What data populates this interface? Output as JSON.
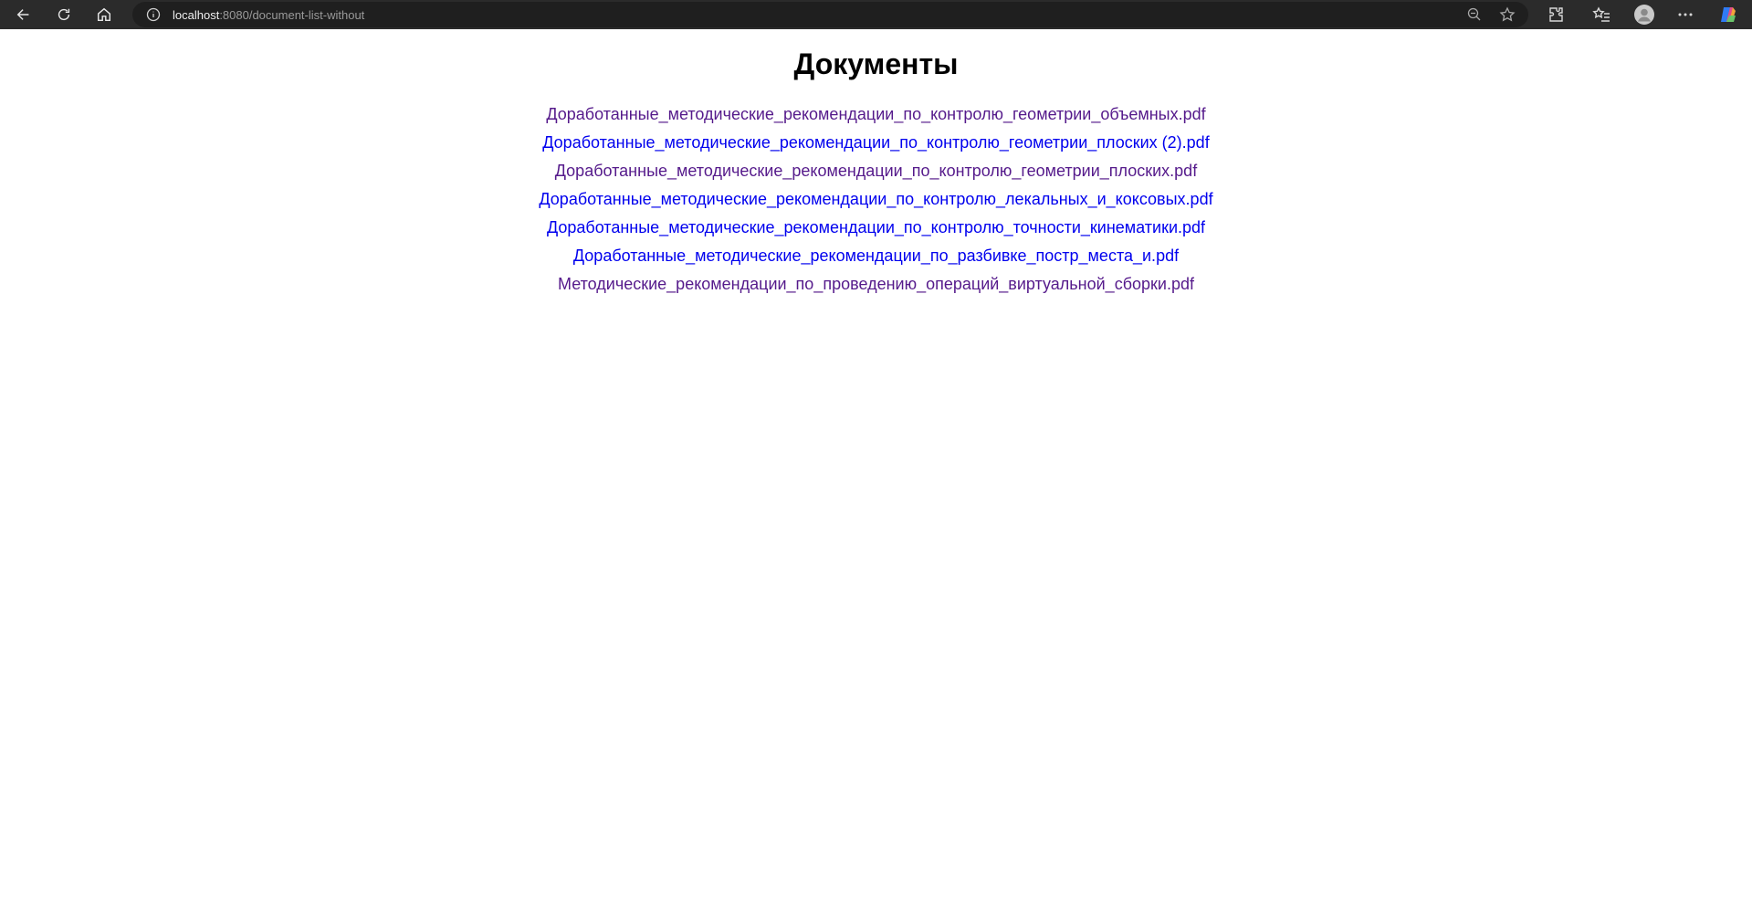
{
  "browser": {
    "url_host": "localhost",
    "url_path": ":8080/document-list-without"
  },
  "page": {
    "title": "Документы"
  },
  "documents": [
    {
      "label": "Доработанные_методические_рекомендации_по_контролю_геометрии_объемных.pdf",
      "visited": true
    },
    {
      "label": "Доработанные_методические_рекомендации_по_контролю_геометрии_плоских (2).pdf",
      "visited": false
    },
    {
      "label": "Доработанные_методические_рекомендации_по_контролю_геометрии_плоских.pdf",
      "visited": true
    },
    {
      "label": "Доработанные_методические_рекомендации_по_контролю_лекальных_и_коксовых.pdf",
      "visited": false
    },
    {
      "label": "Доработанные_методические_рекомендации_по_контролю_точности_кинематики.pdf",
      "visited": false
    },
    {
      "label": "Доработанные_методические_рекомендации_по_разбивке_постр_места_и.pdf",
      "visited": false
    },
    {
      "label": "Методические_рекомендации_по_проведению_операций_виртуальной_сборки.pdf",
      "visited": true
    }
  ],
  "colors": {
    "link": "#0000ee",
    "visited_link": "#551a8b"
  }
}
